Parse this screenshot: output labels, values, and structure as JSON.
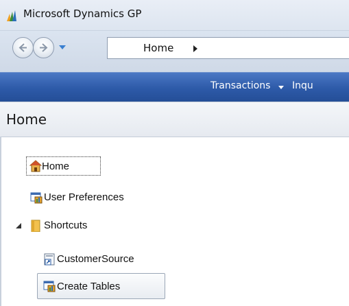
{
  "window": {
    "title": "Microsoft Dynamics GP"
  },
  "address_bar": {
    "path": "Home"
  },
  "menu": {
    "items": [
      "Transactions",
      "Inqu"
    ]
  },
  "page": {
    "title": "Home"
  },
  "nav_tree": {
    "items": [
      {
        "label": "Home",
        "icon": "home-icon",
        "focused": true
      },
      {
        "label": "User Preferences",
        "icon": "window-icon"
      },
      {
        "label": "Shortcuts",
        "icon": "folder-icon",
        "expanded": true
      },
      {
        "label": "CustomerSource",
        "icon": "shortcut-icon"
      },
      {
        "label": "Create Tables",
        "icon": "window-icon",
        "selected": true
      }
    ]
  },
  "colors": {
    "menu_bar": "#2d5aa8",
    "title_bar": "#e3e9f3",
    "folder": "#f2c14e"
  }
}
